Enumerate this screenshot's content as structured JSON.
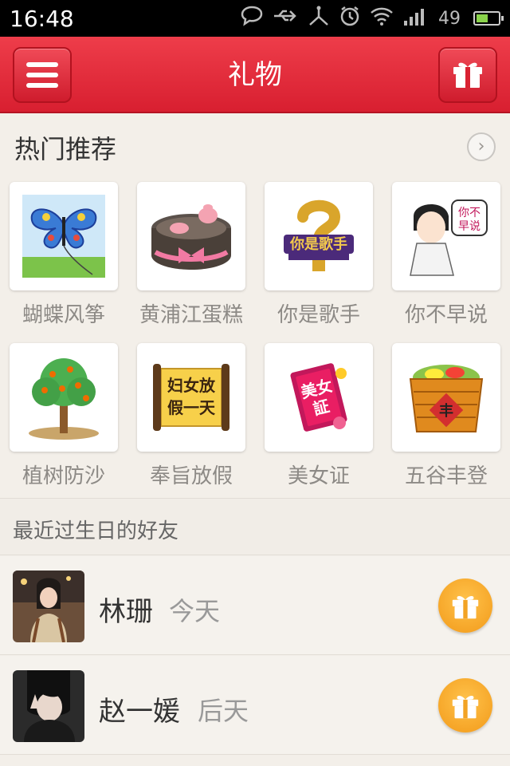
{
  "status_bar": {
    "time": "16:48",
    "battery": "49"
  },
  "title_bar": {
    "title": "礼物"
  },
  "hot": {
    "label": "热门推荐",
    "more_icon": "chevron-right-icon",
    "gifts": [
      {
        "name": "蝴蝶风筝"
      },
      {
        "name": "黄浦江蛋糕"
      },
      {
        "name": "你是歌手"
      },
      {
        "name": "你不早说"
      },
      {
        "name": "植树防沙"
      },
      {
        "name": "奉旨放假"
      },
      {
        "name": "美女证"
      },
      {
        "name": "五谷丰登"
      }
    ]
  },
  "birthdays": {
    "label": "最近过生日的好友",
    "friends": [
      {
        "name": "林珊",
        "when": "今天"
      },
      {
        "name": "赵一媛",
        "when": "后天"
      }
    ]
  },
  "colors": {
    "brand_red": "#e02a39",
    "gift_orange": "#f5a623"
  }
}
